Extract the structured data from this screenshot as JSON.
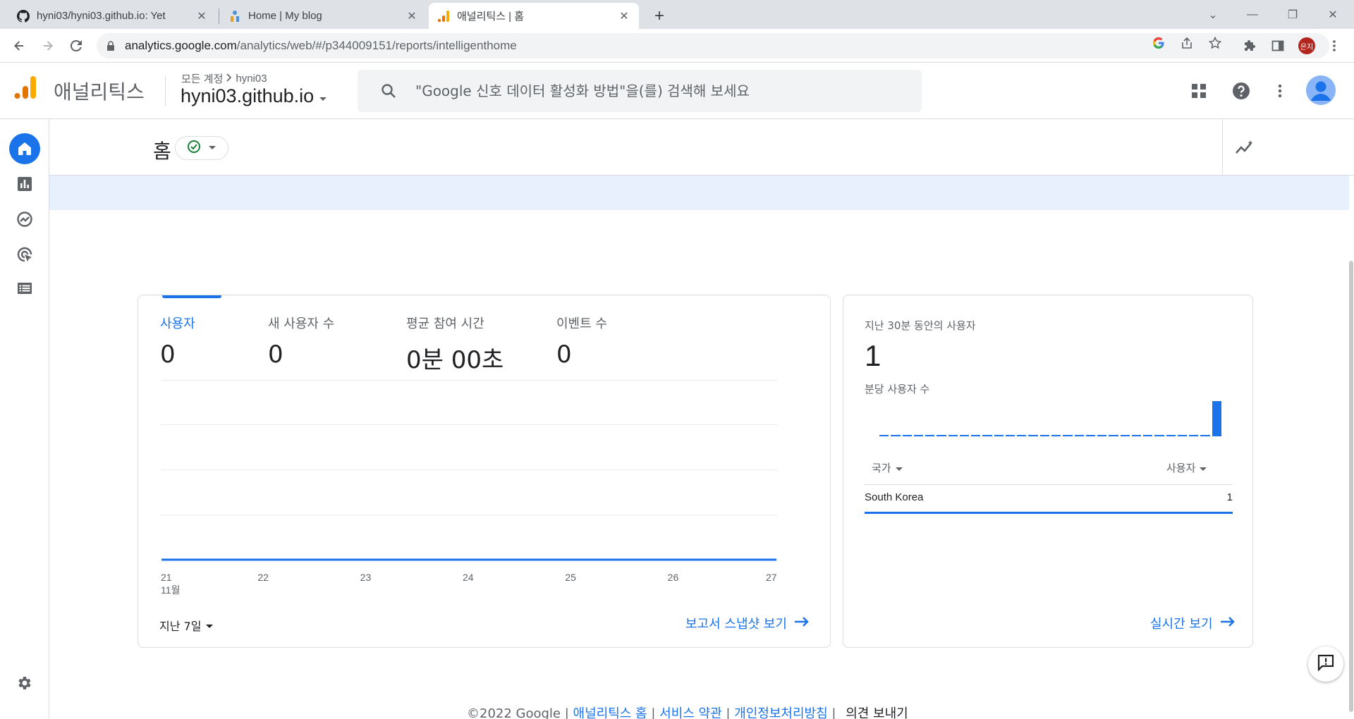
{
  "browser": {
    "tabs": [
      {
        "title": "hyni03/hyni03.github.io: Yet",
        "favicon": "github-icon",
        "active": false
      },
      {
        "title": "Home | My blog",
        "favicon": "blog-icon",
        "active": false
      },
      {
        "title": "애널리틱스 | 홈",
        "favicon": "analytics-icon",
        "active": true
      }
    ],
    "url_host": "analytics.google.com",
    "url_path": "/analytics/web/#/p344009151/reports/intelligenthome",
    "profile_initials": "은지"
  },
  "ga_header": {
    "brand": "애널리틱스",
    "crumb_all": "모든 계정",
    "crumb_account": "hyni03",
    "property": "hyni03.github.io",
    "search_placeholder": "\"Google 신호 데이터 활성화 방법\"을(를) 검색해 보세요"
  },
  "page": {
    "title": "홈"
  },
  "overview": {
    "metrics": [
      {
        "label": "사용자",
        "value": "0"
      },
      {
        "label": "새 사용자 수",
        "value": "0"
      },
      {
        "label": "평균 참여 시간",
        "value": "0분 00초"
      },
      {
        "label": "이벤트 수",
        "value": "0"
      }
    ],
    "range_label": "지난 7일",
    "link_label": "보고서 스냅샷 보기"
  },
  "chart_data": {
    "type": "line",
    "x": [
      "21",
      "22",
      "23",
      "24",
      "25",
      "26",
      "27"
    ],
    "x_sub_label": "11월",
    "series": [
      {
        "name": "사용자",
        "values": [
          0,
          0,
          0,
          0,
          0,
          0,
          0
        ]
      }
    ],
    "grid": true
  },
  "realtime": {
    "title": "지난 30분 동안의 사용자",
    "value": "1",
    "per_minute_label": "분당 사용자 수",
    "per_minute_values": [
      0,
      0,
      0,
      0,
      0,
      0,
      0,
      0,
      0,
      0,
      0,
      0,
      0,
      0,
      0,
      0,
      0,
      0,
      0,
      0,
      0,
      0,
      0,
      0,
      0,
      0,
      0,
      0,
      0,
      1
    ],
    "col_country": "국가",
    "col_users": "사용자",
    "rows": [
      {
        "country": "South Korea",
        "users": "1"
      }
    ],
    "link_label": "실시간 보기"
  },
  "footer": {
    "copyright": "©2022 Google",
    "link_home": "애널리틱스 홈",
    "link_terms": "서비스 약관",
    "link_privacy": "개인정보처리방침",
    "feedback": "의견 보내기"
  },
  "colors": {
    "accent": "#1a73e8",
    "ga_orange": "#f9ab00",
    "ga_orange_dark": "#e37400"
  }
}
